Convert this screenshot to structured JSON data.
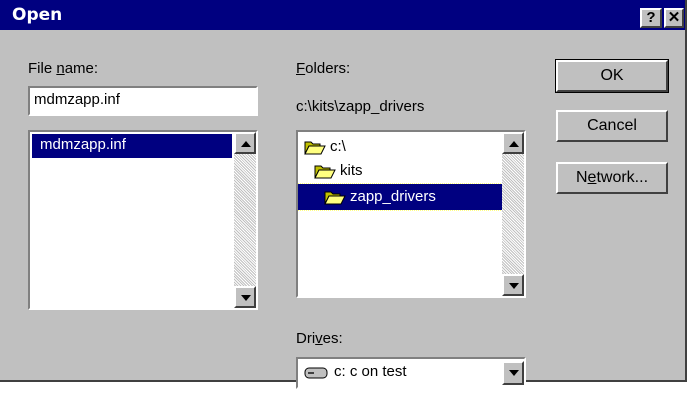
{
  "window": {
    "title": "Open",
    "help_btn": "?",
    "close_btn": "✕"
  },
  "file_name": {
    "label_pre": "File ",
    "label_u": "n",
    "label_post": "ame:",
    "value": "mdmzapp.inf",
    "list": [
      "mdmzapp.inf"
    ]
  },
  "folders": {
    "label_u": "F",
    "label_post": "olders:",
    "current_path": "c:\\kits\\zapp_drivers",
    "items": [
      {
        "name": "c:\\",
        "icon": "open-folder-icon"
      },
      {
        "name": "kits",
        "icon": "open-folder-icon"
      },
      {
        "name": "zapp_drivers",
        "icon": "open-folder-icon",
        "selected": true
      }
    ]
  },
  "drives": {
    "label_pre": "Dri",
    "label_u": "v",
    "label_post": "es:",
    "selected": "c: c on test",
    "icon": "hard-drive-icon"
  },
  "buttons": {
    "ok": "OK",
    "cancel": "Cancel",
    "network_pre": "N",
    "network_u": "e",
    "network_post": "twork..."
  }
}
